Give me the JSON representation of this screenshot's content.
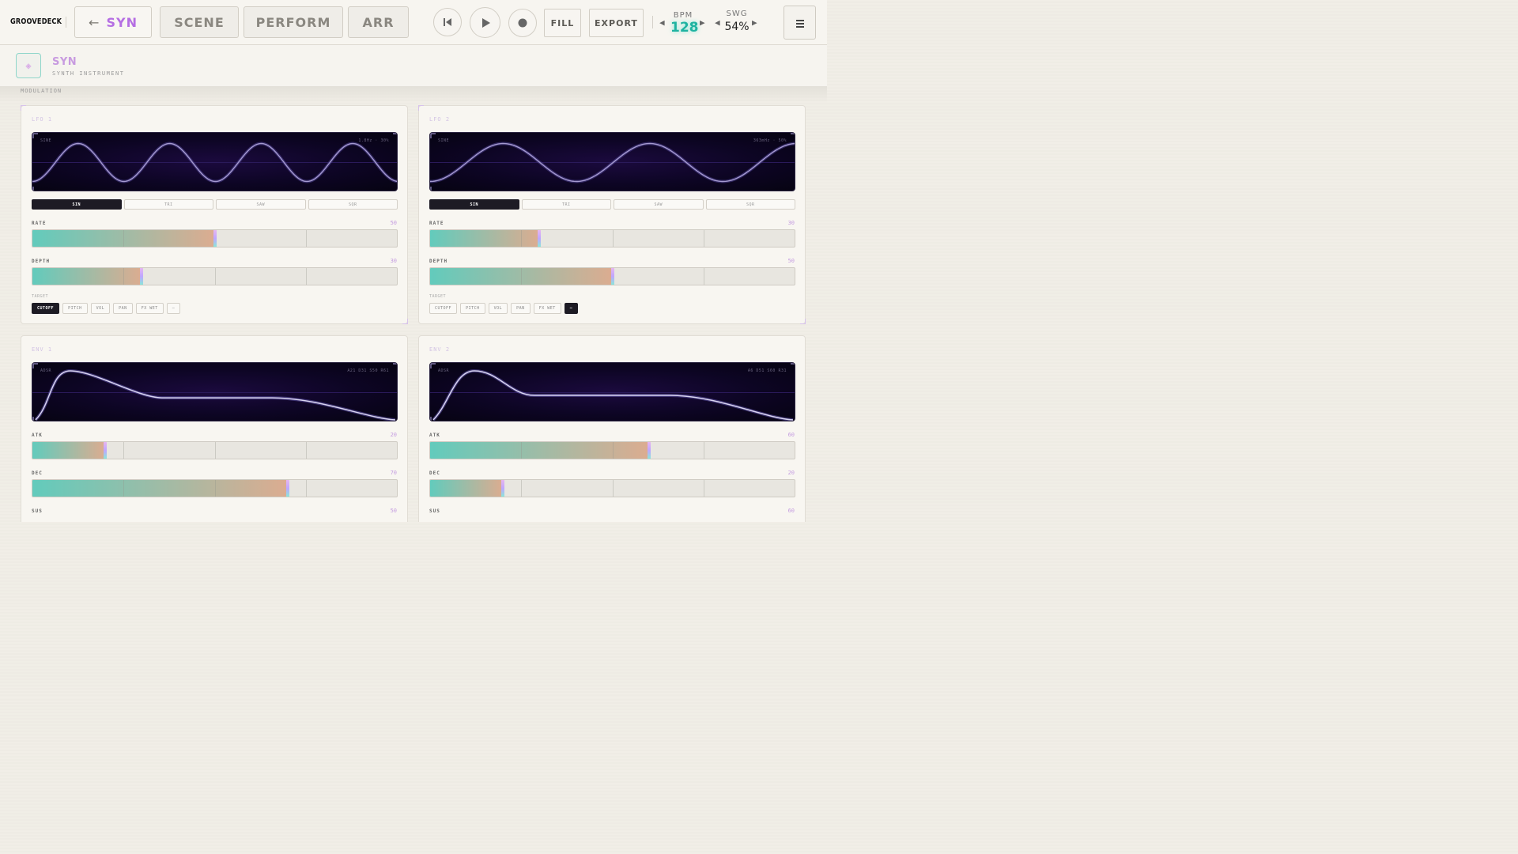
{
  "app": {
    "logo": "GROOVEDECK"
  },
  "tabs": [
    {
      "label": "SYN",
      "active": true,
      "icon": "arrow-left-icon"
    },
    {
      "label": "SCENE",
      "active": false
    },
    {
      "label": "PERFORM",
      "active": false
    },
    {
      "label": "ARR",
      "active": false
    }
  ],
  "transport": {
    "icons": [
      "skip-back-icon",
      "play-icon",
      "record-icon"
    ],
    "fill_label": "FILL",
    "export_label": "EXPORT"
  },
  "bpm": {
    "label": "BPM",
    "value": "128"
  },
  "swing": {
    "label": "SWG",
    "value": "54%"
  },
  "instrument": {
    "title": "SYN",
    "subtitle": "SYNTH INSTRUMENT",
    "icon": "diamond-icon"
  },
  "section": {
    "label": "MODULATION"
  },
  "lfos": [
    {
      "title": "LFO 1",
      "scope_left": "SINE",
      "scope_right": "1.8Hz · 30%",
      "waves": [
        "SIN",
        "TRI",
        "SAW",
        "SQR"
      ],
      "selected_wave": 0,
      "cycles": 4,
      "knobs": [
        {
          "label": "RATE",
          "value": 50
        },
        {
          "label": "DEPTH",
          "value": 30
        }
      ],
      "target_label": "TARGET",
      "targets": [
        "CUTOFF",
        "PITCH",
        "VOL",
        "PAN",
        "FX WET",
        "—"
      ],
      "selected_target": 0
    },
    {
      "title": "LFO 2",
      "scope_left": "SINE",
      "scope_right": "363mHz · 50%",
      "waves": [
        "SIN",
        "TRI",
        "SAW",
        "SQR"
      ],
      "selected_wave": 0,
      "cycles": 2.5,
      "knobs": [
        {
          "label": "RATE",
          "value": 30
        },
        {
          "label": "DEPTH",
          "value": 50
        }
      ],
      "target_label": "TARGET",
      "targets": [
        "CUTOFF",
        "PITCH",
        "VOL",
        "PAN",
        "FX WET",
        "—"
      ],
      "selected_target": 5
    }
  ],
  "envs": [
    {
      "title": "ENV 1",
      "scope_left": "ADSR",
      "scope_right": "A21 D31 S50 R61",
      "knobs": [
        {
          "label": "ATK",
          "value": 20
        },
        {
          "label": "DEC",
          "value": 70
        },
        {
          "label": "SUS",
          "value": 50
        }
      ]
    },
    {
      "title": "ENV 2",
      "scope_left": "ADSR",
      "scope_right": "A6 D51 S60 R31",
      "knobs": [
        {
          "label": "ATK",
          "value": 60
        },
        {
          "label": "DEC",
          "value": 20
        },
        {
          "label": "SUS",
          "value": 60
        }
      ]
    }
  ],
  "colors": {
    "accent_purple": "#b56ee3",
    "accent_teal": "#1fb3a1",
    "slider_start": "#62cbbc",
    "slider_end": "#dcac90"
  }
}
